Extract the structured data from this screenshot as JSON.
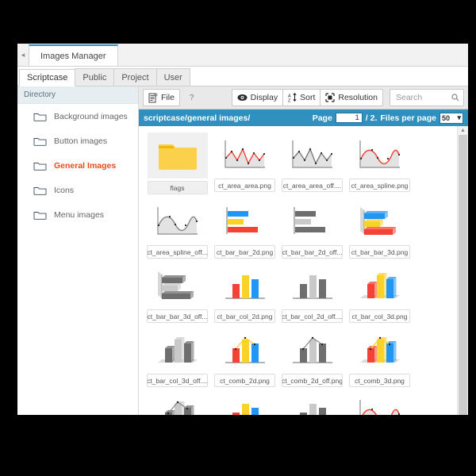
{
  "window": {
    "app_tab": "Images Manager",
    "collapse_icon": "chevron-left-icon"
  },
  "subtabs": [
    {
      "label": "Scriptcase",
      "active": true
    },
    {
      "label": "Public",
      "active": false
    },
    {
      "label": "Project",
      "active": false
    },
    {
      "label": "User",
      "active": false
    }
  ],
  "sidebar": {
    "header": "Directory",
    "items": [
      {
        "label": "Background images",
        "active": false
      },
      {
        "label": "Button images",
        "active": false
      },
      {
        "label": "General Images",
        "active": true
      },
      {
        "label": "Icons",
        "active": false
      },
      {
        "label": "Menu images",
        "active": false
      }
    ]
  },
  "toolbar": {
    "file_label": "File",
    "file_icon": "document-icon",
    "help_label": "?",
    "display_label": "Display",
    "display_icon": "eye-icon",
    "sort_label": "Sort",
    "sort_icon": "sort-az-icon",
    "resolution_label": "Resolution",
    "resolution_icon": "resize-icon",
    "search_value": "",
    "search_placeholder": "Search",
    "search_icon": "search-icon"
  },
  "breadcrumb": {
    "path": "scriptcase/general images/",
    "page_label": "Page",
    "page_value": "1",
    "page_total": "/ 2.",
    "files_per_page_label": "Files per page",
    "files_per_page_value": "50",
    "dropdown_icon": "chevron-down-icon"
  },
  "colors": {
    "accent_blue": "#3091be",
    "tab_blue": "#2f93d1",
    "active_dir_red": "#f04a1e",
    "folder_yellow": "#fbd04a",
    "chart_red": "#f44336",
    "chart_yellow": "#fcd228",
    "chart_blue": "#2196f3",
    "chart_gray": "#6e6e6e",
    "chart_lightgray": "#c9c9c9"
  },
  "files": [
    {
      "name": "flags",
      "type": "folder",
      "selected": true
    },
    {
      "name": "ct_area_area.png",
      "type": "area-color",
      "selected": false
    },
    {
      "name": "ct_area_area_off....",
      "type": "area-gray",
      "selected": false
    },
    {
      "name": "ct_area_spline.png",
      "type": "spline-color",
      "selected": false
    },
    {
      "name": "ct_area_spline_off...",
      "type": "spline-gray",
      "selected": false
    },
    {
      "name": "ct_bar_bar_2d.png",
      "type": "bar2d-color",
      "selected": false
    },
    {
      "name": "ct_bar_bar_2d_off...",
      "type": "bar2d-gray",
      "selected": false
    },
    {
      "name": "ct_bar_bar_3d.png",
      "type": "bar3d-color",
      "selected": false
    },
    {
      "name": "ct_bar_bar_3d_off...",
      "type": "bar3d-gray",
      "selected": false
    },
    {
      "name": "ct_bar_col_2d.png",
      "type": "col2d-color",
      "selected": false
    },
    {
      "name": "ct_bar_col_2d_off....",
      "type": "col2d-gray",
      "selected": false
    },
    {
      "name": "ct_bar_col_3d.png",
      "type": "col3d-color",
      "selected": false
    },
    {
      "name": "ct_bar_col_3d_off....",
      "type": "col3d-gray",
      "selected": false
    },
    {
      "name": "ct_comb_2d.png",
      "type": "comb2d-color",
      "selected": false
    },
    {
      "name": "ct_comb_2d_off.png",
      "type": "comb2d-gray",
      "selected": false
    },
    {
      "name": "ct_comb_3d.png",
      "type": "comb3d-color",
      "selected": false
    },
    {
      "name": "",
      "type": "comb3d-gray",
      "selected": false
    },
    {
      "name": "",
      "type": "col2d-color",
      "selected": false
    },
    {
      "name": "",
      "type": "col2d-gray",
      "selected": false
    },
    {
      "name": "",
      "type": "spline-color",
      "selected": false
    }
  ],
  "scrollbar": {
    "up_icon": "arrow-up-icon"
  }
}
